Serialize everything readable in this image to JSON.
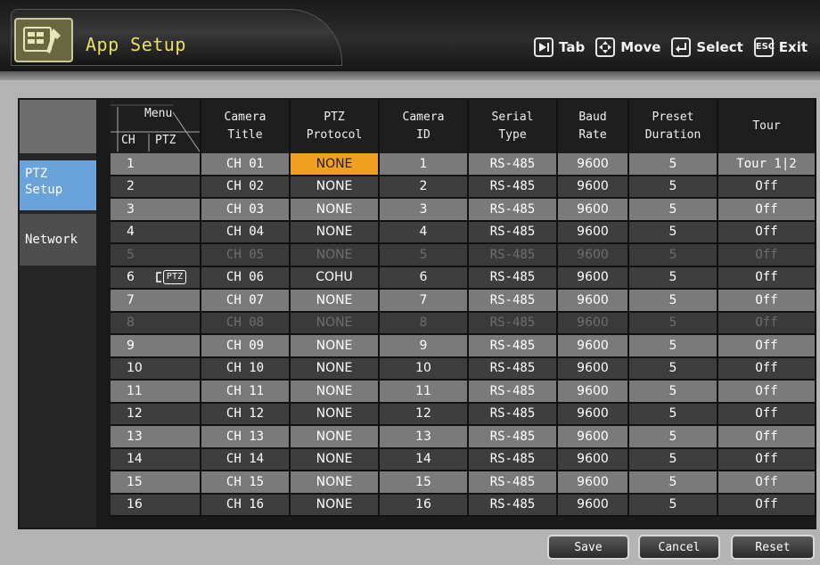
{
  "header": {
    "title": "App Setup",
    "hints": [
      {
        "key": "tab-key-icon",
        "label": "Tab"
      },
      {
        "key": "move-key-icon",
        "label": "Move"
      },
      {
        "key": "select-key-icon",
        "label": "Select"
      },
      {
        "key": "ESC",
        "label": "Exit"
      }
    ]
  },
  "sidebar": {
    "items": [
      {
        "line1": "PTZ",
        "line2": "Setup",
        "active": true
      },
      {
        "line1": "Network",
        "active": false
      }
    ]
  },
  "table": {
    "headers": {
      "menu": "Menu",
      "menu_ch": "CH",
      "menu_ptz": "PTZ",
      "camera_title_1": "Camera",
      "camera_title_2": "Title",
      "ptz_protocol_1": "PTZ",
      "ptz_protocol_2": "Protocol",
      "camera_id_1": "Camera",
      "camera_id_2": "ID",
      "serial_type_1": "Serial",
      "serial_type_2": "Type",
      "baud_rate_1": "Baud",
      "baud_rate_2": "Rate",
      "preset_duration_1": "Preset",
      "preset_duration_2": "Duration",
      "tour": "Tour"
    },
    "ptz_badge": "PTZ",
    "rows": [
      {
        "ch": "1",
        "title": "CH 01",
        "protocol": "NONE",
        "id": "1",
        "serial": "RS-485",
        "baud": "9600",
        "preset": "5",
        "tour": "Tour 1|2"
      },
      {
        "ch": "2",
        "title": "CH 02",
        "protocol": "NONE",
        "id": "2",
        "serial": "RS-485",
        "baud": "9600",
        "preset": "5",
        "tour": "Off"
      },
      {
        "ch": "3",
        "title": "CH 03",
        "protocol": "NONE",
        "id": "3",
        "serial": "RS-485",
        "baud": "9600",
        "preset": "5",
        "tour": "Off"
      },
      {
        "ch": "4",
        "title": "CH 04",
        "protocol": "NONE",
        "id": "4",
        "serial": "RS-485",
        "baud": "9600",
        "preset": "5",
        "tour": "Off"
      },
      {
        "ch": "5",
        "title": "CH 05",
        "protocol": "NONE",
        "id": "5",
        "serial": "RS-485",
        "baud": "9600",
        "preset": "5",
        "tour": "Off"
      },
      {
        "ch": "6",
        "title": "CH 06",
        "protocol": "COHU",
        "id": "6",
        "serial": "RS-485",
        "baud": "9600",
        "preset": "5",
        "tour": "Off"
      },
      {
        "ch": "7",
        "title": "CH 07",
        "protocol": "NONE",
        "id": "7",
        "serial": "RS-485",
        "baud": "9600",
        "preset": "5",
        "tour": "Off"
      },
      {
        "ch": "8",
        "title": "CH 08",
        "protocol": "NONE",
        "id": "8",
        "serial": "RS-485",
        "baud": "9600",
        "preset": "5",
        "tour": "Off"
      },
      {
        "ch": "9",
        "title": "CH 09",
        "protocol": "NONE",
        "id": "9",
        "serial": "RS-485",
        "baud": "9600",
        "preset": "5",
        "tour": "Off"
      },
      {
        "ch": "10",
        "title": "CH 10",
        "protocol": "NONE",
        "id": "10",
        "serial": "RS-485",
        "baud": "9600",
        "preset": "5",
        "tour": "Off"
      },
      {
        "ch": "11",
        "title": "CH 11",
        "protocol": "NONE",
        "id": "11",
        "serial": "RS-485",
        "baud": "9600",
        "preset": "5",
        "tour": "Off"
      },
      {
        "ch": "12",
        "title": "CH 12",
        "protocol": "NONE",
        "id": "12",
        "serial": "RS-485",
        "baud": "9600",
        "preset": "5",
        "tour": "Off"
      },
      {
        "ch": "13",
        "title": "CH 13",
        "protocol": "NONE",
        "id": "13",
        "serial": "RS-485",
        "baud": "9600",
        "preset": "5",
        "tour": "Off"
      },
      {
        "ch": "14",
        "title": "CH 14",
        "protocol": "NONE",
        "id": "14",
        "serial": "RS-485",
        "baud": "9600",
        "preset": "5",
        "tour": "Off"
      },
      {
        "ch": "15",
        "title": "CH 15",
        "protocol": "NONE",
        "id": "15",
        "serial": "RS-485",
        "baud": "9600",
        "preset": "5",
        "tour": "Off"
      },
      {
        "ch": "16",
        "title": "CH 16",
        "protocol": "NONE",
        "id": "16",
        "serial": "RS-485",
        "baud": "9600",
        "preset": "5",
        "tour": "Off"
      }
    ]
  },
  "buttons": {
    "save": "Save",
    "cancel": "Cancel",
    "reset": "Reset"
  },
  "colors": {
    "selected_cell": "#f0a020",
    "active_tab": "#6aa2da",
    "title_text": "#e8e060"
  }
}
